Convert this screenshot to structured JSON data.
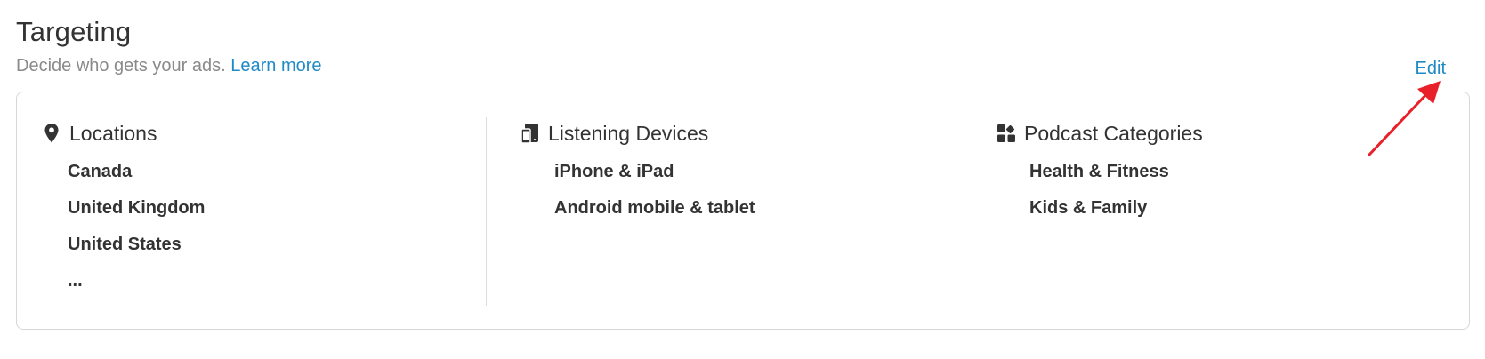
{
  "header": {
    "title": "Targeting",
    "subtitle": "Decide who gets your ads.",
    "learn_more": "Learn more",
    "edit": "Edit"
  },
  "columns": {
    "locations": {
      "heading": "Locations",
      "icon": "map-pin-icon",
      "items": [
        "Canada",
        "United Kingdom",
        "United States",
        "..."
      ]
    },
    "devices": {
      "heading": "Listening Devices",
      "icon": "devices-icon",
      "items": [
        "iPhone & iPad",
        "Android mobile & tablet"
      ]
    },
    "categories": {
      "heading": "Podcast Categories",
      "icon": "categories-icon",
      "items": [
        "Health & Fitness",
        "Kids & Family"
      ]
    }
  },
  "colors": {
    "link": "#1f8ac6",
    "text": "#333333",
    "muted": "#8a8a8a",
    "border": "#d7d7d7",
    "annotation_arrow": "#e8202a"
  }
}
